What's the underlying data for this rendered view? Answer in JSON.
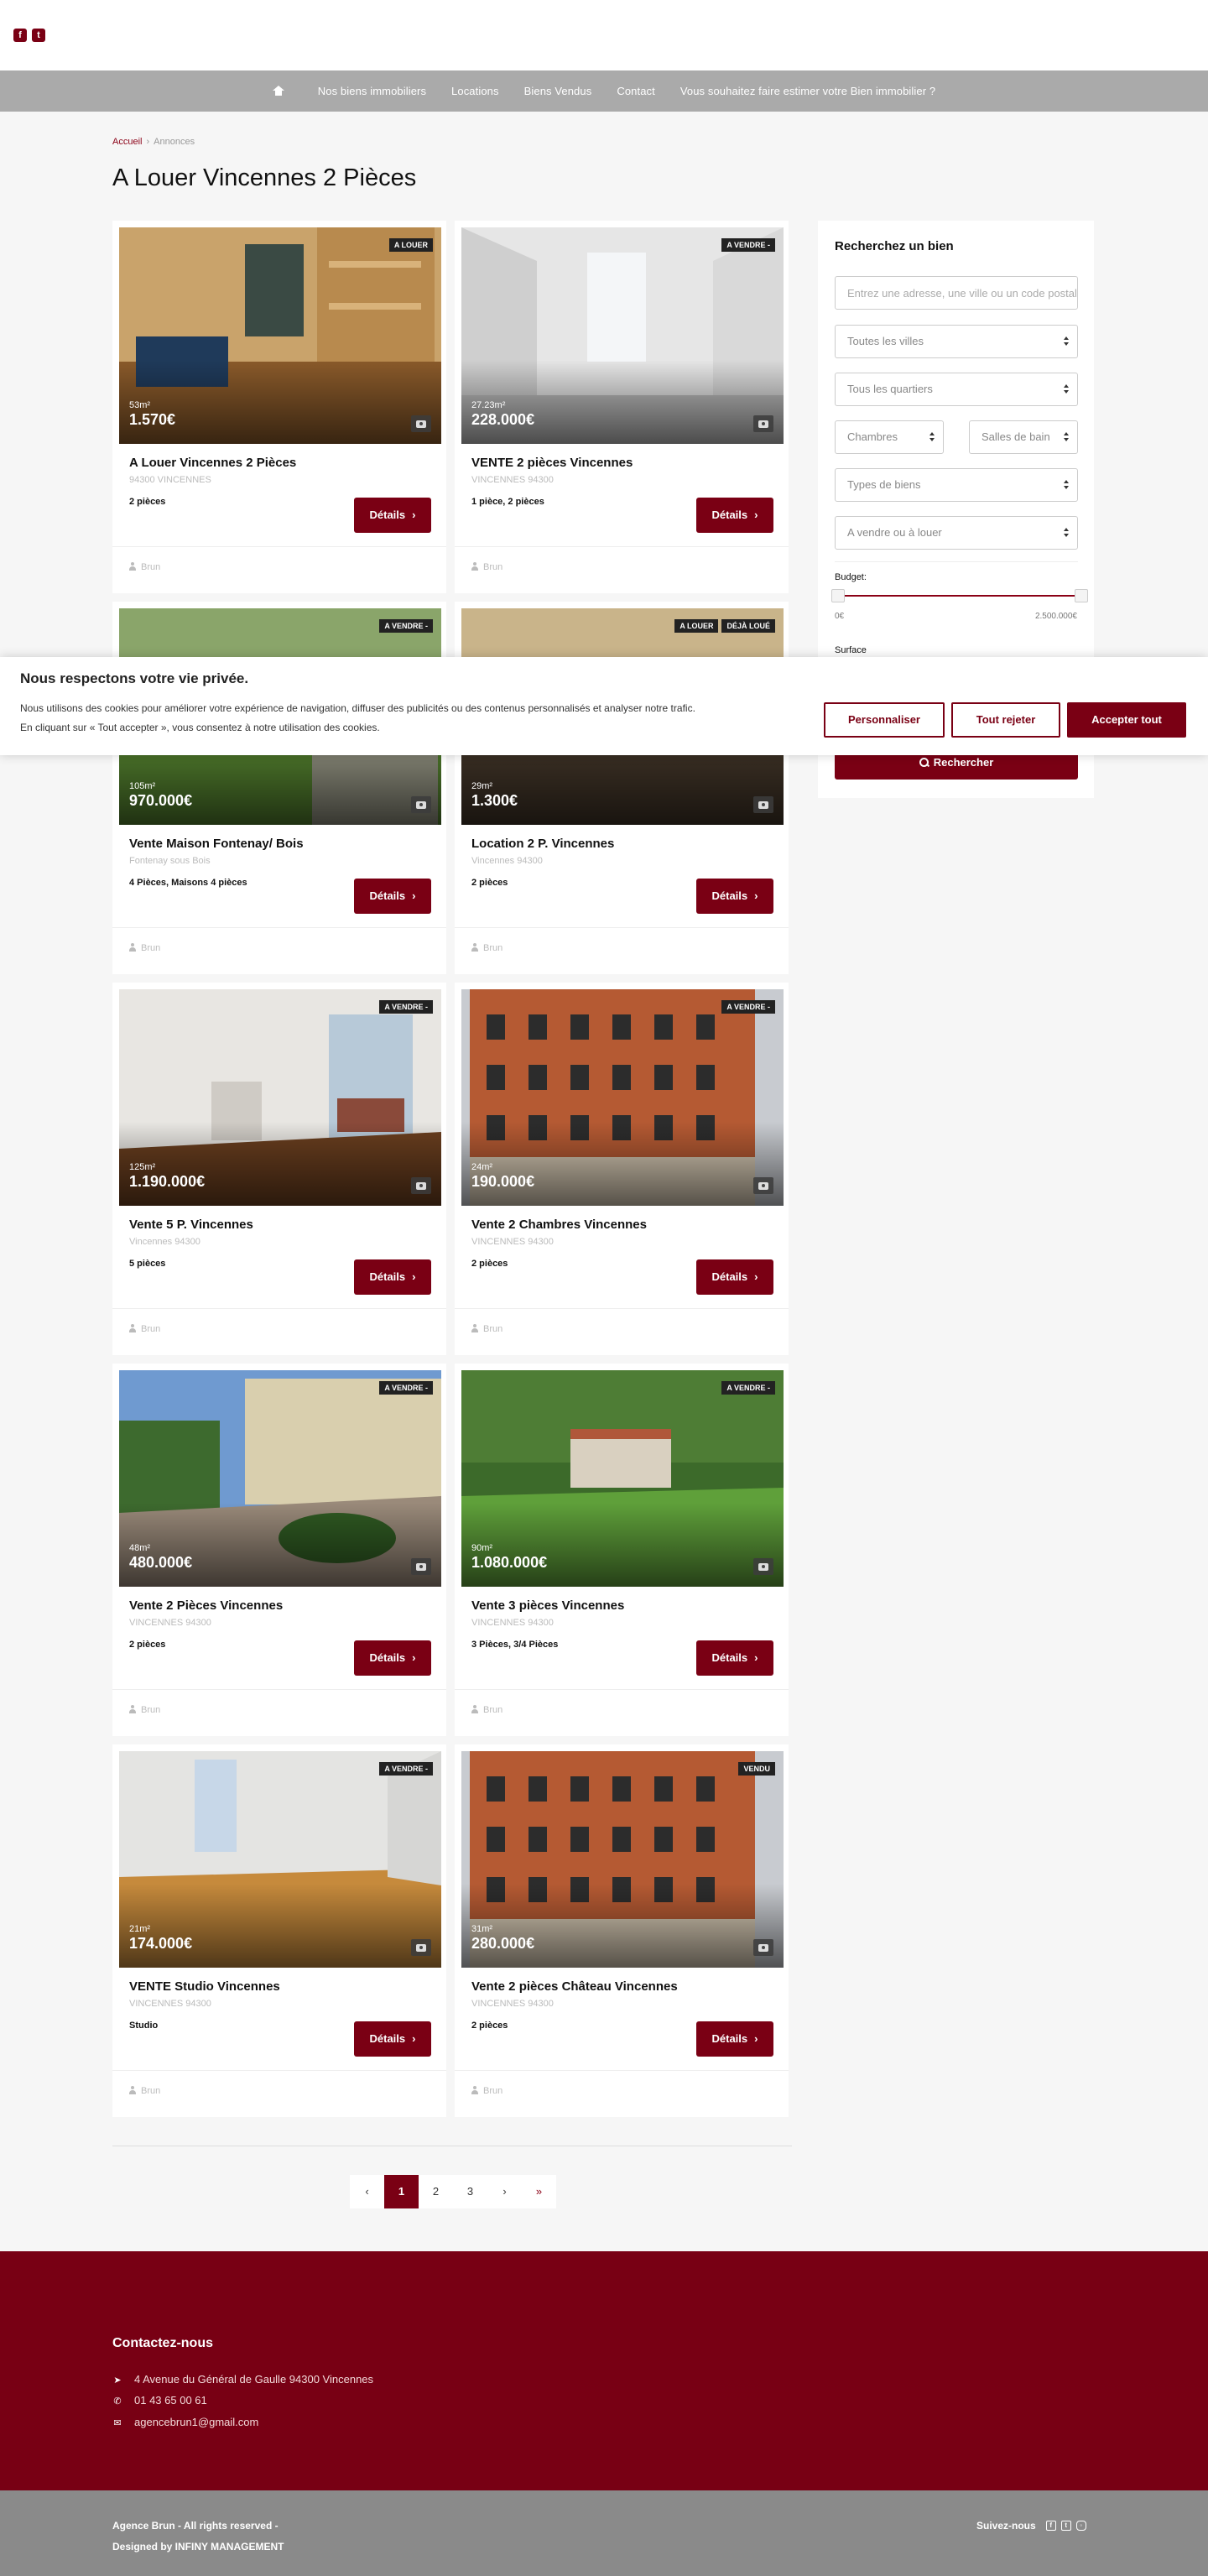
{
  "header": {
    "social": [
      {
        "name": "facebook-icon",
        "glyph": "f"
      },
      {
        "name": "twitter-icon",
        "glyph": "t"
      }
    ]
  },
  "nav": {
    "items": [
      "Nos biens immobiliers",
      "Locations",
      "Biens Vendus",
      "Contact",
      "Vous souhaitez faire estimer votre Bien immobilier ?"
    ]
  },
  "breadcrumb": {
    "home": "Accueil",
    "separator": "›",
    "current": "Annonces"
  },
  "page_title": "A Louer Vincennes 2 Pièces",
  "listings": [
    {
      "badges": [
        "A LOUER"
      ],
      "area": "53m²",
      "price": "1.570€",
      "title": "A Louer Vincennes 2 Pièces",
      "address": "94300 VINCENNES",
      "rooms": "2 pièces",
      "details": "Détails",
      "agent": "Brun",
      "scene": "living-room"
    },
    {
      "badges": [
        "A VENDRE -"
      ],
      "area": "27.23m²",
      "price": "228.000€",
      "title": "VENTE 2 pièces Vincennes",
      "address": "VINCENNES 94300",
      "rooms": "1 pièce, 2 pièces",
      "details": "Détails",
      "agent": "Brun",
      "scene": "empty-room"
    },
    {
      "badges": [
        "A VENDRE -"
      ],
      "area": "105m²",
      "price": "970.000€",
      "title": "Vente Maison Fontenay/ Bois",
      "address": "Fontenay sous Bois",
      "rooms": "4 Pièces, Maisons 4 pièces",
      "details": "Détails",
      "agent": "Brun",
      "scene": "garden"
    },
    {
      "badges": [
        "A LOUER",
        "DÉJÀ LOUÉ"
      ],
      "area": "29m²",
      "price": "1.300€",
      "title": "Location 2 P. Vincennes",
      "address": "Vincennes 94300",
      "rooms": "2 pièces",
      "details": "Détails",
      "agent": "Brun",
      "scene": "dark-room"
    },
    {
      "badges": [
        "A VENDRE -"
      ],
      "area": "125m²",
      "price": "1.190.000€",
      "title": "Vente 5 P. Vincennes",
      "address": "Vincennes 94300",
      "rooms": "5 pièces",
      "details": "Détails",
      "agent": "Brun",
      "scene": "bright-room"
    },
    {
      "badges": [
        "A VENDRE -"
      ],
      "area": "24m²",
      "price": "190.000€",
      "title": "Vente 2 Chambres Vincennes",
      "address": "VINCENNES 94300",
      "rooms": "2 pièces",
      "details": "Détails",
      "agent": "Brun",
      "scene": "facade"
    },
    {
      "badges": [
        "A VENDRE -"
      ],
      "area": "48m²",
      "price": "480.000€",
      "title": "Vente 2 Pièces Vincennes",
      "address": "VINCENNES 94300",
      "rooms": "2 pièces",
      "details": "Détails",
      "agent": "Brun",
      "scene": "courtyard"
    },
    {
      "badges": [
        "A VENDRE -"
      ],
      "area": "90m²",
      "price": "1.080.000€",
      "title": "Vente 3 pièces Vincennes",
      "address": "VINCENNES 94300",
      "rooms": "3 Pièces, 3/4 Pièces",
      "details": "Détails",
      "agent": "Brun",
      "scene": "lawn"
    },
    {
      "badges": [
        "A VENDRE -"
      ],
      "area": "21m²",
      "price": "174.000€",
      "title": "VENTE Studio Vincennes",
      "address": "VINCENNES 94300",
      "rooms": "Studio",
      "details": "Détails",
      "agent": "Brun",
      "scene": "parquet-room"
    },
    {
      "badges": [
        "VENDU"
      ],
      "area": "31m²",
      "price": "280.000€",
      "title": "Vente 2 pièces Château Vincennes",
      "address": "VINCENNES 94300",
      "rooms": "2 pièces",
      "details": "Détails",
      "agent": "Brun",
      "scene": "facade"
    }
  ],
  "search": {
    "title": "Recherchez un bien",
    "address_placeholder": "Entrez une adresse, une ville ou un code postal",
    "city": "Toutes les villes",
    "district": "Tous les quartiers",
    "bedrooms": "Chambres",
    "bathrooms": "Salles de bain",
    "type": "Types de biens",
    "transaction": "A vendre ou à louer",
    "budget_label": "Budget:",
    "budget_min": "0€",
    "budget_max": "2.500.000€",
    "budget_range": [
      0,
      2500000
    ],
    "surface_label": "Surface",
    "submit": "Rechercher"
  },
  "cookie": {
    "title": "Nous respectons votre vie privée.",
    "line1": "Nous utilisons des cookies pour améliorer votre expérience de navigation, diffuser des publicités ou des contenus personnalisés et analyser notre trafic.",
    "line2": "En cliquant sur « Tout accepter », vous consentez à notre utilisation des cookies.",
    "customize": "Personnaliser",
    "reject": "Tout rejeter",
    "accept": "Accepter tout"
  },
  "pagination": {
    "prev": "‹",
    "pages": [
      "1",
      "2",
      "3"
    ],
    "current": "1",
    "next": "›",
    "last": "»"
  },
  "footer": {
    "contact_title": "Contactez-nous",
    "address": "4 Avenue du Général de Gaulle 94300 Vincennes",
    "phone": "01 43 65 00 61",
    "email": "agencebrun1@gmail.com",
    "copyright": "Agence Brun - All rights reserved -",
    "designed": "Designed by INFINY MANAGEMENT",
    "follow": "Suivez-nous"
  },
  "colors": {
    "brand": "#7a0014",
    "nav_bg": "#aaaaaa",
    "footer_bottom": "#8a8a8a"
  }
}
